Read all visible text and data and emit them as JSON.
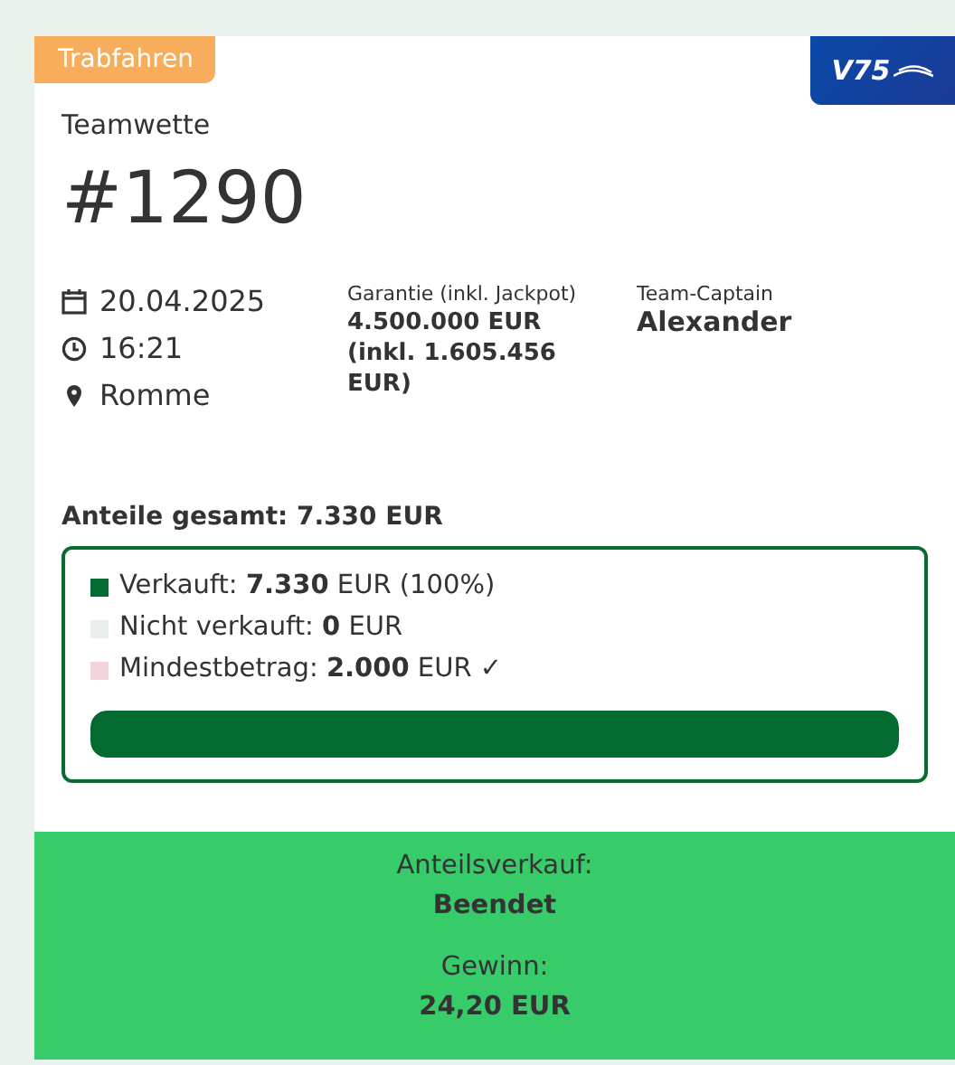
{
  "category_badge": "Trabfahren",
  "logo": {
    "text": "V75"
  },
  "bet_type": "Teamwette",
  "bet_number": "#1290",
  "details": [
    {
      "kind": "date",
      "text": "20.04.2025"
    },
    {
      "kind": "time",
      "text": "16:21"
    },
    {
      "kind": "location",
      "text": "Romme"
    }
  ],
  "guarantee": {
    "label": "Garantie (inkl. Jackpot)",
    "value": "4.500.000 EUR (inkl. 1.605.456 EUR)"
  },
  "captain": {
    "label": "Team-Captain",
    "value": "Alexander"
  },
  "shares_total": "Anteile gesamt: 7.330 EUR",
  "legend": [
    {
      "text": "Verkauft: **7.330** EUR (100%)",
      "color": "#006b32"
    },
    {
      "text": "Nicht verkauft: **0** EUR",
      "color": "#e8efec"
    },
    {
      "text": "Mindestbetrag: **2.000** EUR ✓",
      "color": "#f2d3da"
    }
  ],
  "progress": {
    "level": 1
  },
  "status": {
    "sale_label": "Anteilsverkauf:",
    "sale_value": "Beendet",
    "win_label": "Gewinn:",
    "win_value": "24,20 EUR"
  }
}
